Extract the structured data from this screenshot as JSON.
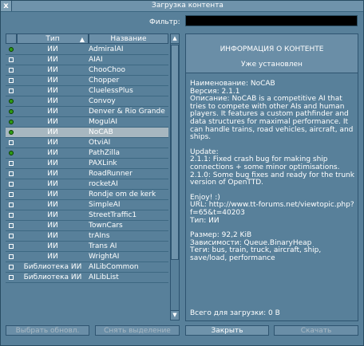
{
  "window": {
    "title": "Загрузка контента",
    "close_glyph": "x"
  },
  "filter": {
    "label": "Фильтр:",
    "value": ""
  },
  "list": {
    "headers": {
      "type": "Тип",
      "type_sort_glyph": "▲",
      "name": "Название"
    },
    "rows": [
      {
        "status": "green",
        "type": "ИИ",
        "name": "AdmiralAI"
      },
      {
        "status": "box",
        "type": "ИИ",
        "name": "AIAI"
      },
      {
        "status": "box",
        "type": "ИИ",
        "name": "ChooChoo"
      },
      {
        "status": "box",
        "type": "ИИ",
        "name": "Chopper"
      },
      {
        "status": "box",
        "type": "ИИ",
        "name": "CluelessPlus"
      },
      {
        "status": "green",
        "type": "ИИ",
        "name": "Convoy"
      },
      {
        "status": "green",
        "type": "ИИ",
        "name": "Denver & Rio Grande"
      },
      {
        "status": "green",
        "type": "ИИ",
        "name": "MogulAI"
      },
      {
        "status": "green",
        "type": "ИИ",
        "name": "NoCAB",
        "selected": true
      },
      {
        "status": "box",
        "type": "ИИ",
        "name": "OtviAI"
      },
      {
        "status": "green",
        "type": "ИИ",
        "name": "PathZilla"
      },
      {
        "status": "box",
        "type": "ИИ",
        "name": "PAXLink"
      },
      {
        "status": "box",
        "type": "ИИ",
        "name": "RoadRunner"
      },
      {
        "status": "box",
        "type": "ИИ",
        "name": "rocketAI"
      },
      {
        "status": "box",
        "type": "ИИ",
        "name": "Rondje om de kerk"
      },
      {
        "status": "box",
        "type": "ИИ",
        "name": "SimpleAI"
      },
      {
        "status": "box",
        "type": "ИИ",
        "name": "StreetTraffic1"
      },
      {
        "status": "box",
        "type": "ИИ",
        "name": "TownCars"
      },
      {
        "status": "box",
        "type": "ИИ",
        "name": "trAIns"
      },
      {
        "status": "box",
        "type": "ИИ",
        "name": "Trans AI"
      },
      {
        "status": "box",
        "type": "ИИ",
        "name": "WrightAI"
      },
      {
        "status": "box",
        "type": "Библиотека ИИ",
        "name": "AILibCommon"
      },
      {
        "status": "box",
        "type": "Библиотека ИИ",
        "name": "AILibList"
      }
    ]
  },
  "info": {
    "title": "ИНФОРМАЦИЯ О КОНТЕНТЕ",
    "status": "Уже установлен",
    "details": [
      "Наименование: NoCAB\nВерсия: 2.1.1\nОписание: NoCAB is a competitive AI that tries to compete with other AIs and human players. It features a custom pathfinder and data structures for maximal performance. It can handle trains, road vehicles, aircraft, and ships.",
      "Update:\n2.1.1: Fixed crash bug for making ship connections + some minor optimisations.\n2.1.0: Some bug fixes and ready for the trunk version of OpenTTD.",
      "Enjoy! :)\nURL: http://www.tt-forums.net/viewtopic.php?f=65&t=40203\nТип: ИИ",
      "Размер: 92,2 KiB\nЗависимости: Queue.BinaryHeap\nТеги: bus, train, truck, aircraft, ship, save/load, performance"
    ],
    "total": "Всего для загрузки: 0 B"
  },
  "buttons": {
    "select_updates": "Выбрать обновл.",
    "deselect_all": "Снять выделение",
    "close": "Закрыть",
    "download": "Скачать"
  },
  "colors": {
    "installed": "#2e9a14",
    "selected_row": "#a7b7c0",
    "background": "#58809a"
  }
}
